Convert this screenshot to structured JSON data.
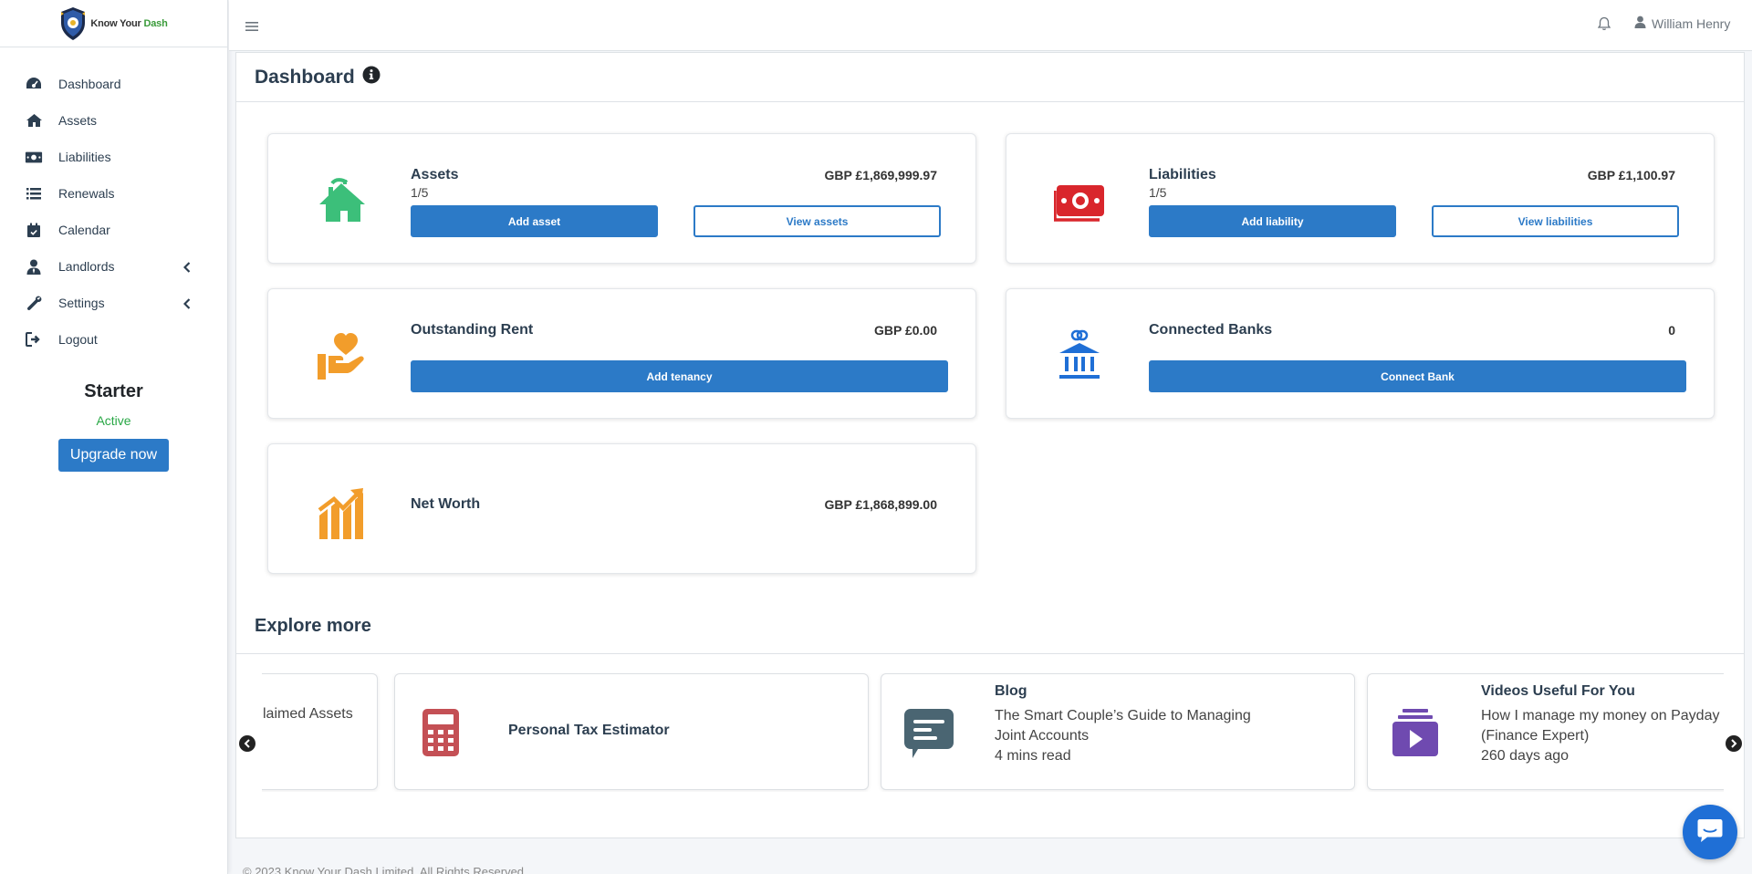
{
  "brand": {
    "name_part1": "Know Your ",
    "name_part2": "Dash"
  },
  "sidebar": {
    "items": [
      {
        "label": "Dashboard",
        "icon": "gauge-icon"
      },
      {
        "label": "Assets",
        "icon": "home-icon"
      },
      {
        "label": "Liabilities",
        "icon": "money-icon"
      },
      {
        "label": "Renewals",
        "icon": "list-icon"
      },
      {
        "label": "Calendar",
        "icon": "calendar-icon"
      },
      {
        "label": "Landlords",
        "icon": "user-tie-icon"
      },
      {
        "label": "Settings",
        "icon": "wrench-icon"
      },
      {
        "label": "Logout",
        "icon": "sign-out-icon"
      }
    ],
    "plan": {
      "name": "Starter",
      "status": "Active",
      "upgrade_label": "Upgrade now"
    }
  },
  "topbar": {
    "user_name": "William Henry"
  },
  "page": {
    "title": "Dashboard"
  },
  "cards": {
    "assets": {
      "title": "Assets",
      "count": "1/5",
      "amount": "GBP £1,869,999.97",
      "btn_add": "Add asset",
      "btn_view": "View assets"
    },
    "liabilities": {
      "title": "Liabilities",
      "count": "1/5",
      "amount": "GBP £1,100.97",
      "btn_add": "Add liability",
      "btn_view": "View liabilities"
    },
    "rent": {
      "title": "Outstanding Rent",
      "amount": "GBP £0.00",
      "btn_add": "Add tenancy"
    },
    "banks": {
      "title": "Connected Banks",
      "amount": "0",
      "btn_add": "Connect Bank"
    },
    "networth": {
      "title": "Net Worth",
      "amount": "GBP £1,868,899.00"
    }
  },
  "explore": {
    "title": "Explore more",
    "items": [
      {
        "title": "",
        "text": "laimed Assets"
      },
      {
        "title": "Personal Tax Estimator"
      },
      {
        "title": "Blog",
        "text": "The Smart Couple’s Guide to Managing Joint Accounts",
        "meta": "4 mins read"
      },
      {
        "title": "Videos Useful For You",
        "text": "How I manage my money on Payday (Finance Expert)",
        "meta": "260 days ago"
      }
    ]
  },
  "footer": {
    "text": "© 2023 Know Your Dash Limited. All Rights Reserved."
  },
  "colors": {
    "primary": "#2c7ac7",
    "assets_green": "#3cbf7a",
    "liability_red": "#d9262c",
    "orange": "#f29d2b",
    "bank_blue": "#1f6fd6",
    "tax_red": "#c45055",
    "blog_slate": "#4a6572",
    "video_purple": "#6f4ab0"
  }
}
